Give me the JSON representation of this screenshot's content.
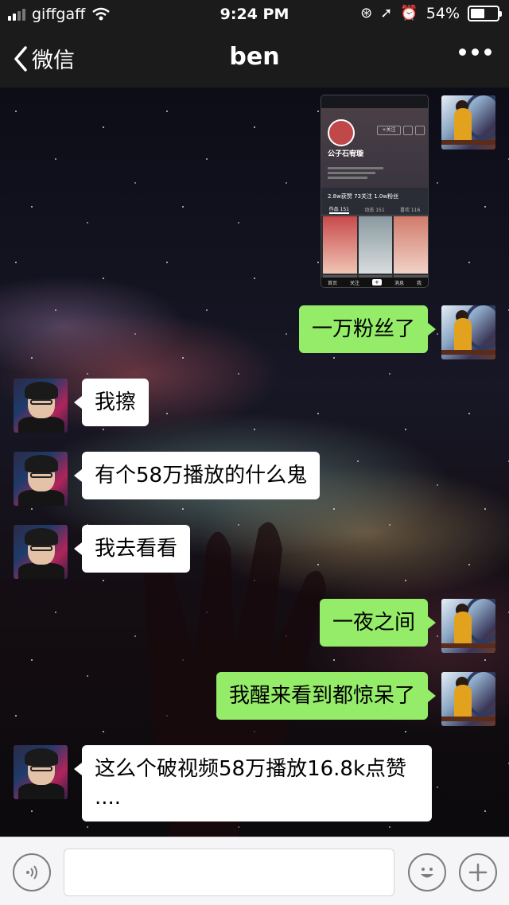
{
  "status_bar": {
    "carrier": "giffgaff",
    "time": "9:24 PM",
    "battery": "54%",
    "battery_level": 0.54
  },
  "nav": {
    "back_label": "微信",
    "title": "ben"
  },
  "shared_screenshot": {
    "profile_name": "公子石宥璇",
    "follow_label": "+关注",
    "stats": "2.8w获赞  73关注  1.0w粉丝",
    "tabs": [
      "作品 151",
      "动态 151",
      "喜欢 116"
    ],
    "bottom_nav": [
      "首页",
      "关注",
      "+",
      "消息",
      "我"
    ]
  },
  "messages": [
    {
      "side": "out",
      "text": "一万粉丝了"
    },
    {
      "side": "in",
      "text": "我擦"
    },
    {
      "side": "in",
      "text": "有个58万播放的什么鬼"
    },
    {
      "side": "in",
      "text": "我去看看"
    },
    {
      "side": "out",
      "text": "一夜之间"
    },
    {
      "side": "out",
      "text": "我醒来看到都惊呆了"
    },
    {
      "side": "in",
      "text": "这么个破视频58万播放16.8k点赞\n...."
    }
  ],
  "icons": {
    "back": "chevron-left-icon",
    "more": "more-icon",
    "voice": "voice-icon",
    "emoji": "emoji-icon",
    "plus": "plus-icon"
  },
  "colors": {
    "outgoing_bubble": "#95ec69",
    "incoming_bubble": "#ffffff",
    "nav_bg": "#1b1b1b",
    "input_bar": "#f5f5f7"
  }
}
